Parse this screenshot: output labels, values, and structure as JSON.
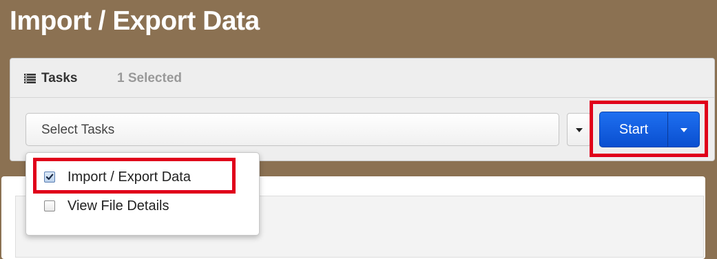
{
  "page": {
    "title": "Import / Export Data"
  },
  "tasks_panel": {
    "icon": "list-icon",
    "label": "Tasks",
    "selected_count": "1 Selected",
    "select": {
      "value": "Select Tasks",
      "toggle_icon": "caret-down-icon"
    },
    "start": {
      "label": "Start",
      "dropdown_icon": "caret-down-icon",
      "color": "#1560e0"
    }
  },
  "task_menu": {
    "items": [
      {
        "label": "Import / Export Data",
        "checked": true
      },
      {
        "label": "View File Details",
        "checked": false
      }
    ]
  },
  "colors": {
    "header_background": "#8b7152",
    "highlight": "#e0001a",
    "primary_button": "#1560e0"
  }
}
